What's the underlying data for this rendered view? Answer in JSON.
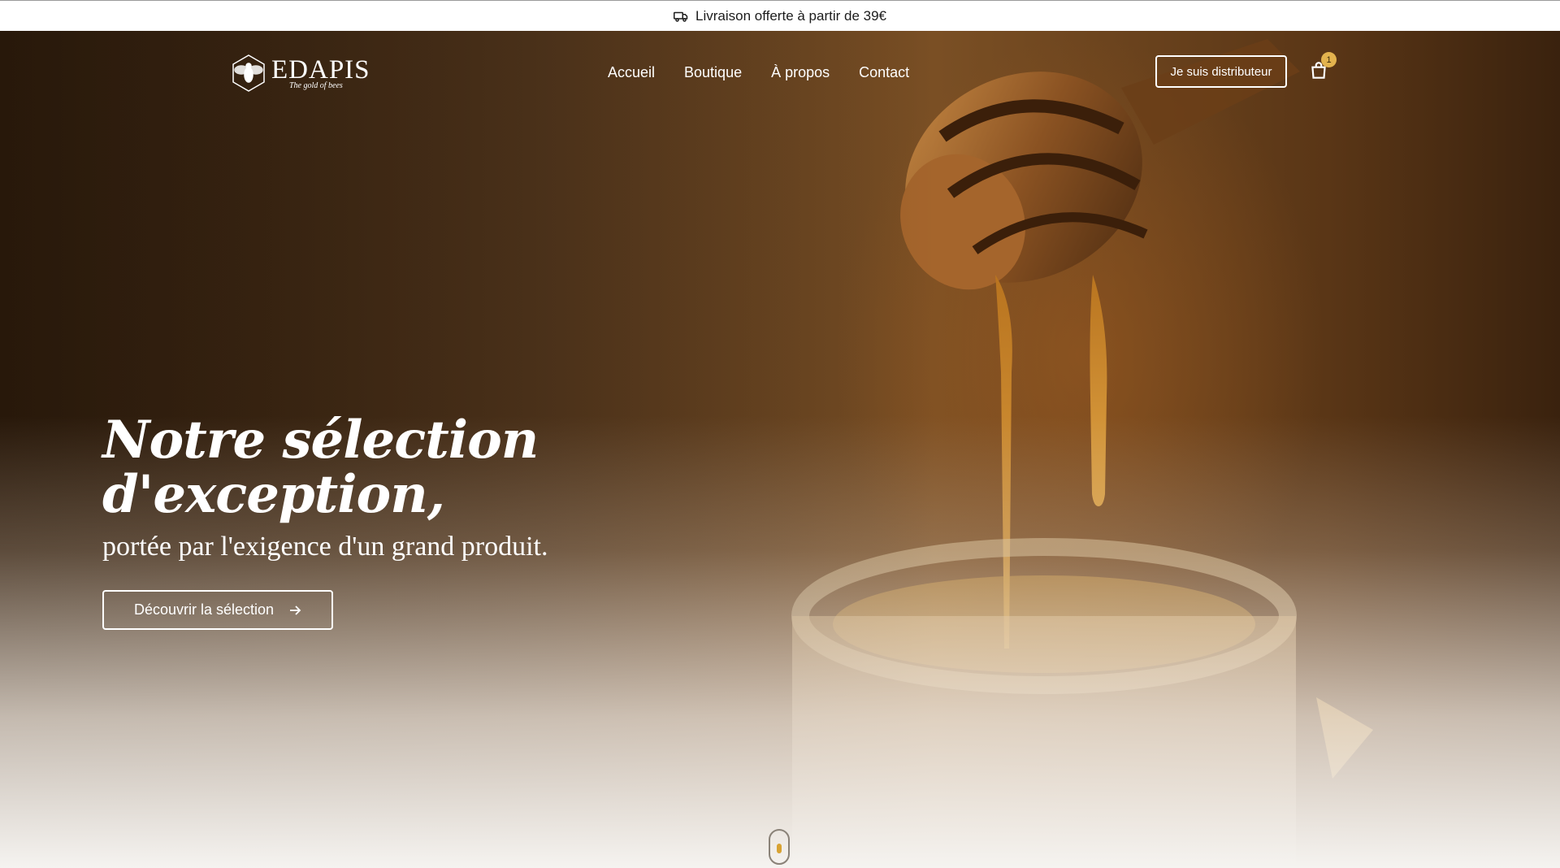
{
  "announcement": {
    "text": "Livraison offerte à partir de 39€",
    "icon": "truck-icon"
  },
  "brand": {
    "name": "EDAPIS",
    "tagline": "The gold of bees",
    "icon": "bee-hexagon-logo-icon"
  },
  "nav": {
    "items": [
      {
        "label": "Accueil"
      },
      {
        "label": "Boutique"
      },
      {
        "label": "À propos"
      },
      {
        "label": "Contact"
      }
    ],
    "distributor_label": "Je suis distributeur",
    "cart": {
      "icon": "shopping-bag-icon",
      "count": "1"
    }
  },
  "hero": {
    "title": "Notre sélection d'exception,",
    "subtitle": "portée par l'exigence d'un grand produit.",
    "cta_label": "Découvrir la sélection",
    "cta_icon": "arrow-right-icon"
  },
  "colors": {
    "accent": "#e3b34e",
    "hero_dark": "#3a2511",
    "honey": "#d8a232"
  }
}
